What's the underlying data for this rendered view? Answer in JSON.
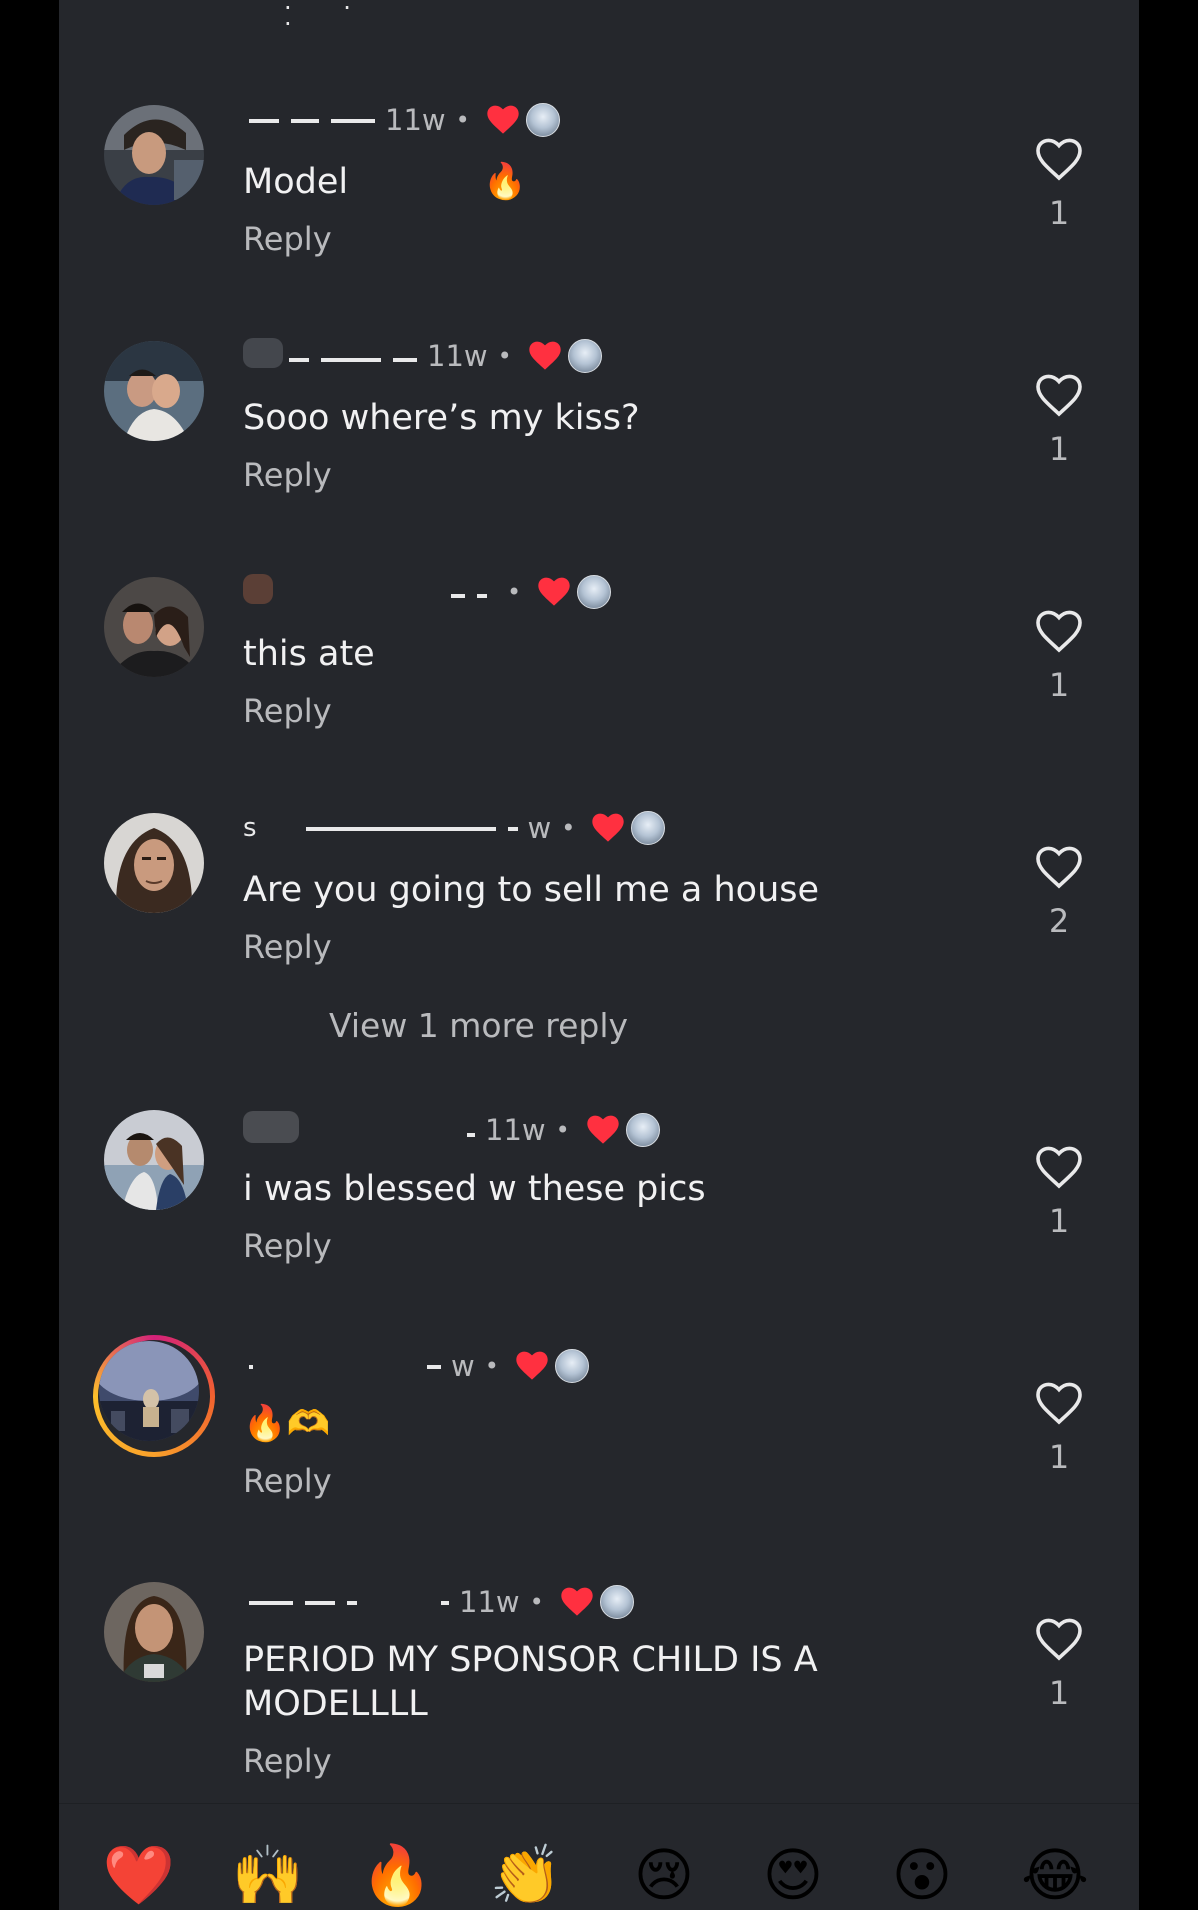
{
  "colors": {
    "panel_bg": "#25272c",
    "text_primary": "#f1f1f2",
    "text_secondary": "#b9babd",
    "heart_red": "#ff3040"
  },
  "top_remnant": "·  ·  ·",
  "comments": [
    {
      "username_visible": "",
      "time": "11w",
      "text": "Model",
      "emoji": "🔥",
      "reply_label": "Reply",
      "like_count": "1"
    },
    {
      "username_visible": "",
      "time": "11w",
      "text": "Sooo where’s my kiss?",
      "reply_label": "Reply",
      "like_count": "1"
    },
    {
      "username_visible": "",
      "time": "",
      "text": "this ate",
      "reply_label": "Reply",
      "like_count": "1"
    },
    {
      "username_visible": "s",
      "time": "w",
      "text": "Are you going to sell me a house",
      "reply_label": "Reply",
      "like_count": "2",
      "view_more_label": "View 1 more reply"
    },
    {
      "username_visible": "",
      "time": "11w",
      "text": "i was blessed w these pics",
      "reply_label": "Reply",
      "like_count": "1"
    },
    {
      "username_visible": "",
      "time": "w",
      "text": "🔥🫶",
      "reply_label": "Reply",
      "like_count": "1"
    },
    {
      "username_visible": "",
      "time": "11w",
      "text": "PERIOD MY SPONSOR CHILD IS A MODELLLL",
      "reply_label": "Reply",
      "like_count": "1"
    }
  ],
  "emoji_bar": [
    "❤️",
    "🙌",
    "🔥",
    "👏",
    "😢",
    "😍",
    "😮",
    "😂"
  ]
}
